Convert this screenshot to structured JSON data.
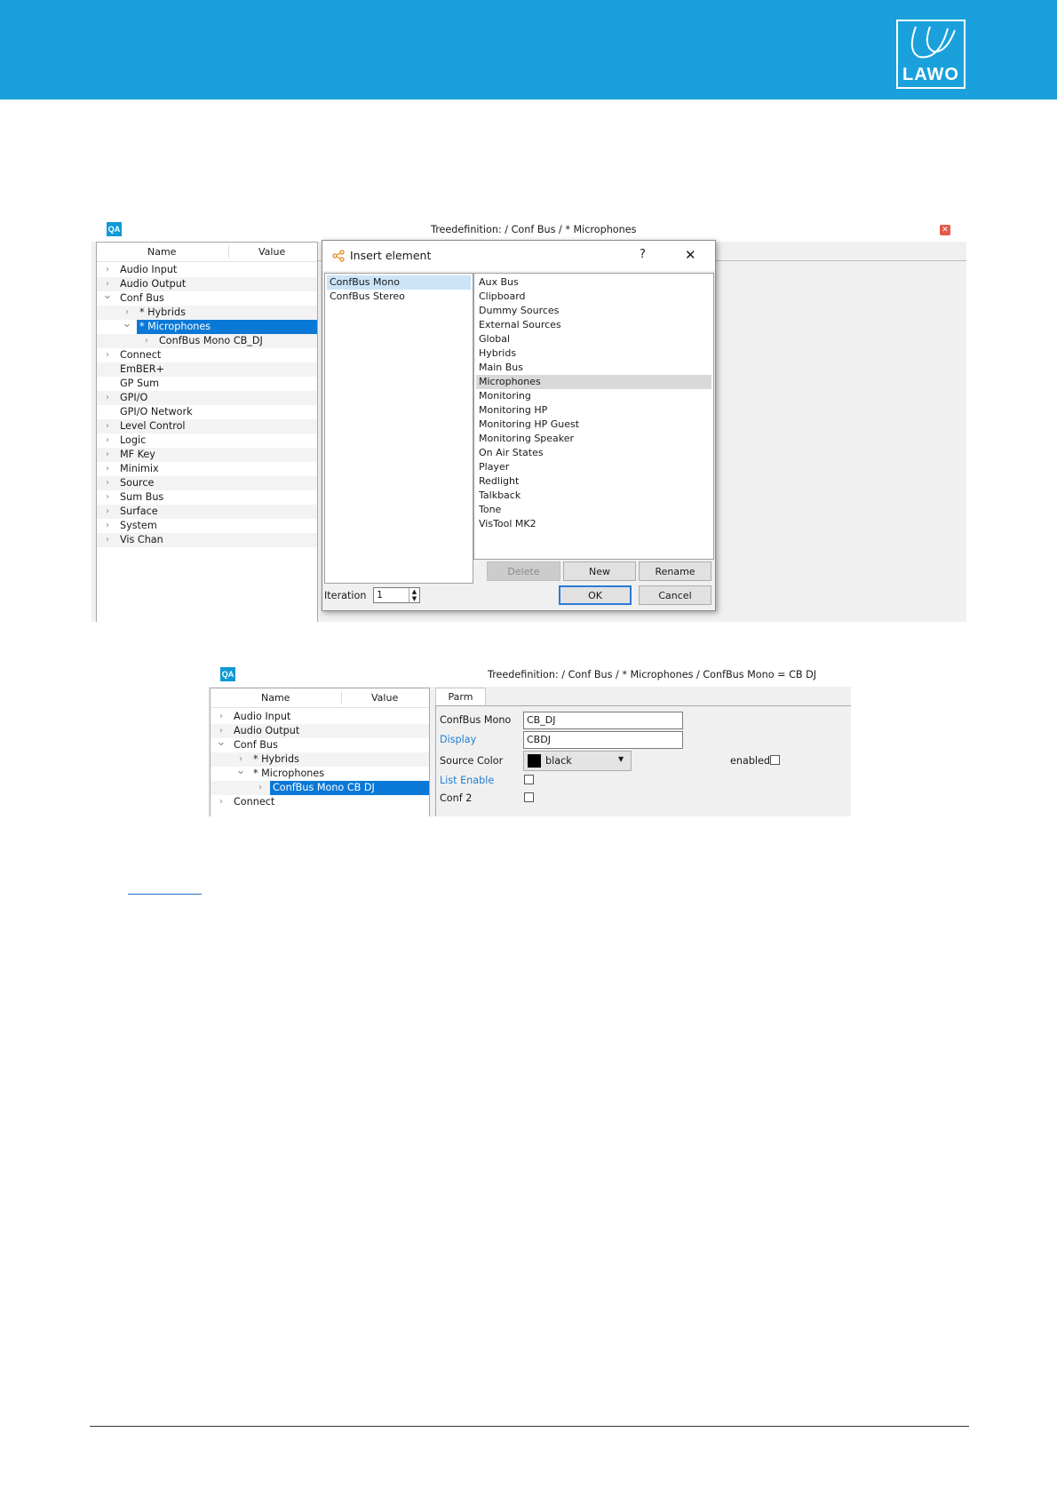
{
  "brand": {
    "logo_text": "LAWO",
    "header_color": "#1aa1db"
  },
  "screen1": {
    "qa_label": "QA",
    "path": "Treedefinition:  / Conf Bus / * Microphones",
    "tree_header": {
      "name": "Name",
      "value": "Value"
    },
    "tree": [
      {
        "label": "Audio Input",
        "chev": "right",
        "indent": 0
      },
      {
        "label": "Audio Output",
        "chev": "right",
        "indent": 0
      },
      {
        "label": "Conf Bus",
        "chev": "down",
        "indent": 0
      },
      {
        "label": "* Hybrids",
        "chev": "right",
        "indent": 1
      },
      {
        "label": "* Microphones",
        "chev": "down",
        "indent": 1,
        "selected": true
      },
      {
        "label": "ConfBus Mono  CB_DJ",
        "chev": "right",
        "indent": 2
      },
      {
        "label": "Connect",
        "chev": "right",
        "indent": 0
      },
      {
        "label": "EmBER+",
        "chev": "",
        "indent": 0
      },
      {
        "label": "GP Sum",
        "chev": "",
        "indent": 0
      },
      {
        "label": "GPI/O",
        "chev": "right",
        "indent": 0
      },
      {
        "label": "GPI/O Network",
        "chev": "",
        "indent": 0
      },
      {
        "label": "Level Control",
        "chev": "right",
        "indent": 0
      },
      {
        "label": "Logic",
        "chev": "right",
        "indent": 0
      },
      {
        "label": "MF Key",
        "chev": "right",
        "indent": 0
      },
      {
        "label": "Minimix",
        "chev": "right",
        "indent": 0
      },
      {
        "label": "Source",
        "chev": "right",
        "indent": 0
      },
      {
        "label": "Sum Bus",
        "chev": "right",
        "indent": 0
      },
      {
        "label": "Surface",
        "chev": "right",
        "indent": 0
      },
      {
        "label": "System",
        "chev": "right",
        "indent": 0
      },
      {
        "label": "Vis Chan",
        "chev": "right",
        "indent": 0
      }
    ]
  },
  "dialog": {
    "title": "Insert element",
    "help": "?",
    "close": "✕",
    "left_items": [
      "ConfBus Mono",
      "ConfBus Stereo"
    ],
    "right_items": [
      "Aux Bus",
      "Clipboard",
      "Dummy Sources",
      "External Sources",
      "Global",
      "Hybrids",
      "Main Bus",
      "Microphones",
      "Monitoring",
      "Monitoring HP",
      "Monitoring HP Guest",
      "Monitoring Speaker",
      "On Air States",
      "Player",
      "Redlight",
      "Talkback",
      "Tone",
      "VisTool MK2"
    ],
    "right_selected": "Microphones",
    "buttons": {
      "delete": "Delete",
      "new": "New",
      "rename": "Rename",
      "ok": "OK",
      "cancel": "Cancel"
    },
    "iteration_label": "Iteration",
    "iteration_value": "1"
  },
  "screen2": {
    "qa_label": "QA",
    "path": "Treedefinition:  / Conf Bus / * Microphones / ConfBus Mono = CB DJ",
    "tree_header": {
      "name": "Name",
      "value": "Value"
    },
    "tree": [
      {
        "label": "Audio Input",
        "chev": "right",
        "indent": 0
      },
      {
        "label": "Audio Output",
        "chev": "right",
        "indent": 0
      },
      {
        "label": "Conf Bus",
        "chev": "down",
        "indent": 0
      },
      {
        "label": "* Hybrids",
        "chev": "right",
        "indent": 1
      },
      {
        "label": "* Microphones",
        "chev": "down",
        "indent": 1
      },
      {
        "label": "ConfBus Mono  CB DJ",
        "chev": "right",
        "indent": 2,
        "selected": true
      },
      {
        "label": "Connect",
        "chev": "right",
        "indent": 0
      }
    ],
    "tab": "Parm",
    "params": {
      "confbus_mono_label": "ConfBus Mono",
      "confbus_mono_value": "CB_DJ",
      "display_label": "Display",
      "display_value": "CBDJ",
      "source_color_label": "Source Color",
      "source_color_value": "black",
      "source_color_swatch": "#000000",
      "enabled_label": "enabled",
      "list_enable_label": "List Enable",
      "conf2_label": "Conf 2"
    }
  }
}
